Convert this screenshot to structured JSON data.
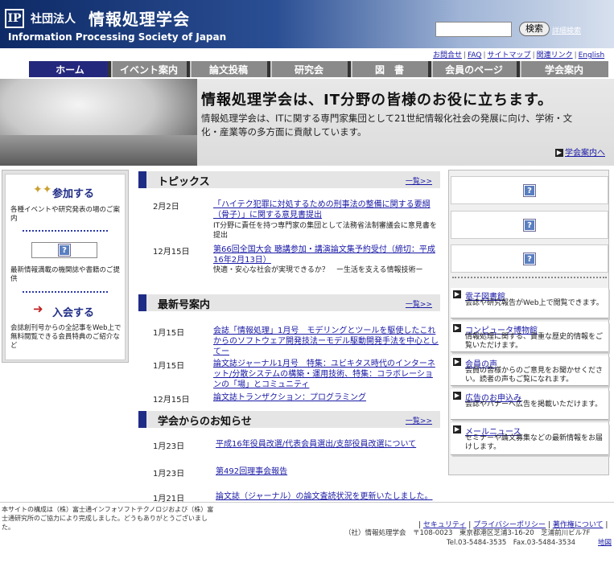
{
  "header": {
    "logo_mark": "IP",
    "org_type": "社団法人",
    "org_name": "情報処理学会",
    "org_name_en": "Information Processing Society of Japan",
    "search_button": "検索",
    "advanced_search": "詳細検索"
  },
  "util_links": [
    "お問合せ",
    "FAQ",
    "サイトマップ",
    "関連リンク",
    "English"
  ],
  "nav": [
    "ホーム",
    "イベント案内",
    "論文投稿",
    "研究会",
    "図　書",
    "会員のページ",
    "学会案内"
  ],
  "hero": {
    "title": "情報処理学会は、IT分野の皆様のお役に立ちます。",
    "desc": "情報処理学会は、ITに関する専門家集団として21世紀情報化社会の発展に向け、学術・文化・産業等の多方面に貢献しています。",
    "link": "学会案内へ"
  },
  "left": {
    "join_title": "参加する",
    "join_desc": "各種イベントや研究発表の場のご案内",
    "latest_desc": "最新情報満載の機関誌や書籍のご提供",
    "member_title": "入会する",
    "member_desc": "会誌創刊号からの全記事をWeb上で無料閲覧できる会員特典のご紹介など"
  },
  "topics": {
    "title": "トピックス",
    "all": "一覧>>",
    "items": [
      {
        "date": "2月2日",
        "link": "「ハイテク犯罪に対処するための刑事法の整備に関する要綱（骨子）」に関する意見書提出",
        "sub": "IT分野に責任を持つ専門家の集団として法務省法制審議会に意見書を提出"
      },
      {
        "date": "12月15日",
        "link": "第66回全国大会 聴講参加・講演論文集予約受付（締切：平成16年2月13日）",
        "sub": "快適・安心な社会が実現できるか？　ー生活を支える情報技術ー"
      }
    ]
  },
  "issues": {
    "title": "最新号案内",
    "all": "一覧>>",
    "items": [
      {
        "date": "1月15日",
        "link": "会誌「情報処理」1月号　モデリングとツールを駆使したこれからのソフトウェア開発技法ーモデル駆動開発手法を中心としてー"
      },
      {
        "date": "1月15日",
        "link": "論文誌ジャーナル1月号　特集：ユビキタス時代のインターネット/分散システムの構築・運用技術、特集：コラボレーションの「場」とコミュニティ"
      },
      {
        "date": "12月15日",
        "link": "論文誌トランザクション：プログラミング"
      }
    ]
  },
  "news": {
    "title": "学会からのお知らせ",
    "all": "一覧>>",
    "items": [
      {
        "date": "1月23日",
        "link": "平成16年役員改選/代表会員選出/支部役員改選について"
      },
      {
        "date": "1月23日",
        "link": "第492回理事会報告"
      },
      {
        "date": "1月21日",
        "link": "論文誌（ジャーナル）の論文査読状況を更新いたしました。"
      }
    ]
  },
  "right": {
    "banner_glyph": "?",
    "items": [
      {
        "title": "電子図書館",
        "desc": "会誌や研究報告がWeb上で閲覧できます。"
      },
      {
        "title": "コンピュータ博物館",
        "desc": "情報処理に関する、貴重な歴史的情報をご覧いただけます。"
      },
      {
        "title": "会員の声",
        "desc": "会員の皆様からのご意見をお聞かせください。読者の声もご覧になれます。"
      },
      {
        "title": "広告のお申込み",
        "desc": "会誌やバナーへ広告を掲載いただけます。"
      },
      {
        "title": "メールニュース",
        "desc": "セミナーや論文募集などの最新情報をお届けします。"
      }
    ]
  },
  "footer": {
    "credit": "本サイトの構成は（株）富士通インフォソフトテクノロジおよび（株）富士通研究所のご協力により完成しました。どうもありがとうございました。",
    "links": [
      "セキュリティ",
      "プライバシーポリシー",
      "著作権について"
    ],
    "org": "（社）情報処理学会　〒108-0023　東京都港区芝浦3-16-20　芝浦前川ビル7F",
    "tel": "Tel.03-5484-3535　Fax.03-5484-3534",
    "map": "地図"
  }
}
